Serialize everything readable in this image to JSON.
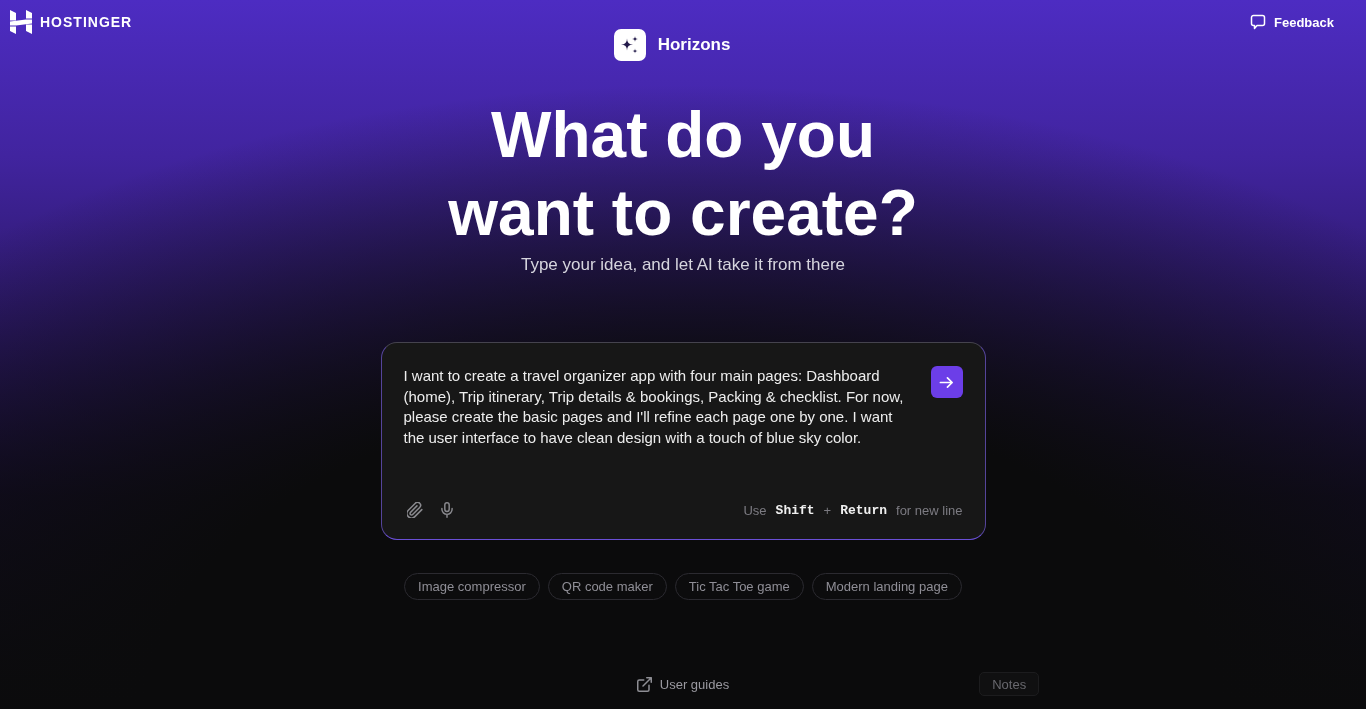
{
  "header": {
    "logo": {
      "text": "HOSTINGER"
    },
    "feedback": {
      "label": "Feedback"
    }
  },
  "brand": {
    "name": "Horizons"
  },
  "hero": {
    "title": "What do you want to create?",
    "subtitle": "Type your idea, and let AI take it from there"
  },
  "prompt": {
    "value": "I want to create a travel organizer app with four main pages: Dashboard (home), Trip itinerary, Trip details & bookings, Packing & checklist. For now, please create the basic pages and I'll refine each page one by one. I want the user interface to have clean design with a touch of blue sky color.",
    "hint": [
      {
        "kind": "text",
        "text": "Use"
      },
      {
        "kind": "key",
        "text": "Shift"
      },
      {
        "kind": "text",
        "text": "+"
      },
      {
        "kind": "key",
        "text": "Return"
      },
      {
        "kind": "text",
        "text": "for new line"
      }
    ]
  },
  "suggestions": [
    {
      "label": "Image compressor"
    },
    {
      "label": "QR code maker"
    },
    {
      "label": "Tic Tac Toe game"
    },
    {
      "label": "Modern landing page"
    }
  ],
  "footer": {
    "user_guides": "User guides",
    "notes": "Notes"
  }
}
